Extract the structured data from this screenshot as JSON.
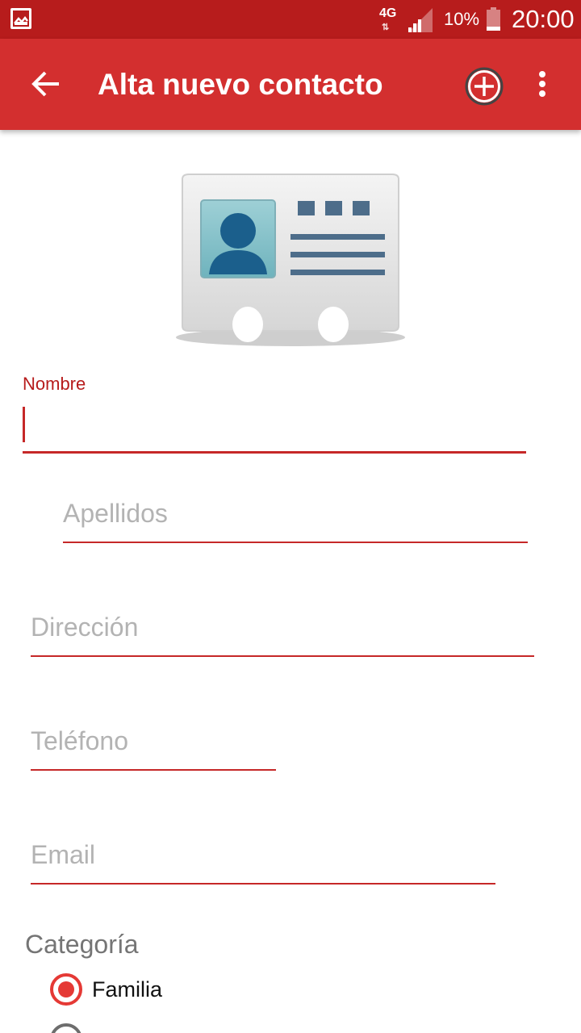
{
  "status_bar": {
    "network": "4G",
    "network_arrows": "⇅",
    "battery_percent": "10%",
    "time": "20:00",
    "icons": [
      "gallery-icon",
      "signal-icon",
      "battery-icon"
    ]
  },
  "toolbar": {
    "title": "Alta nuevo contacto",
    "background": "#d32f2f",
    "icons": [
      "back-arrow-icon",
      "add-circle-icon",
      "overflow-menu-icon"
    ]
  },
  "form": {
    "nombre": {
      "label": "Nombre",
      "value": ""
    },
    "apellidos": {
      "placeholder": "Apellidos"
    },
    "direccion": {
      "placeholder": "Dirección"
    },
    "telefono": {
      "placeholder": "Teléfono"
    },
    "email": {
      "placeholder": "Email"
    },
    "categoria": {
      "label": "Categoría",
      "options": [
        {
          "label": "Familia",
          "selected": true
        },
        {
          "label": "",
          "selected": false
        }
      ]
    }
  },
  "colors": {
    "status_bar": "#b71c1c",
    "accent": "#d32f2f",
    "hint": "#b3b3b3",
    "radio_selected": "#e53935"
  }
}
